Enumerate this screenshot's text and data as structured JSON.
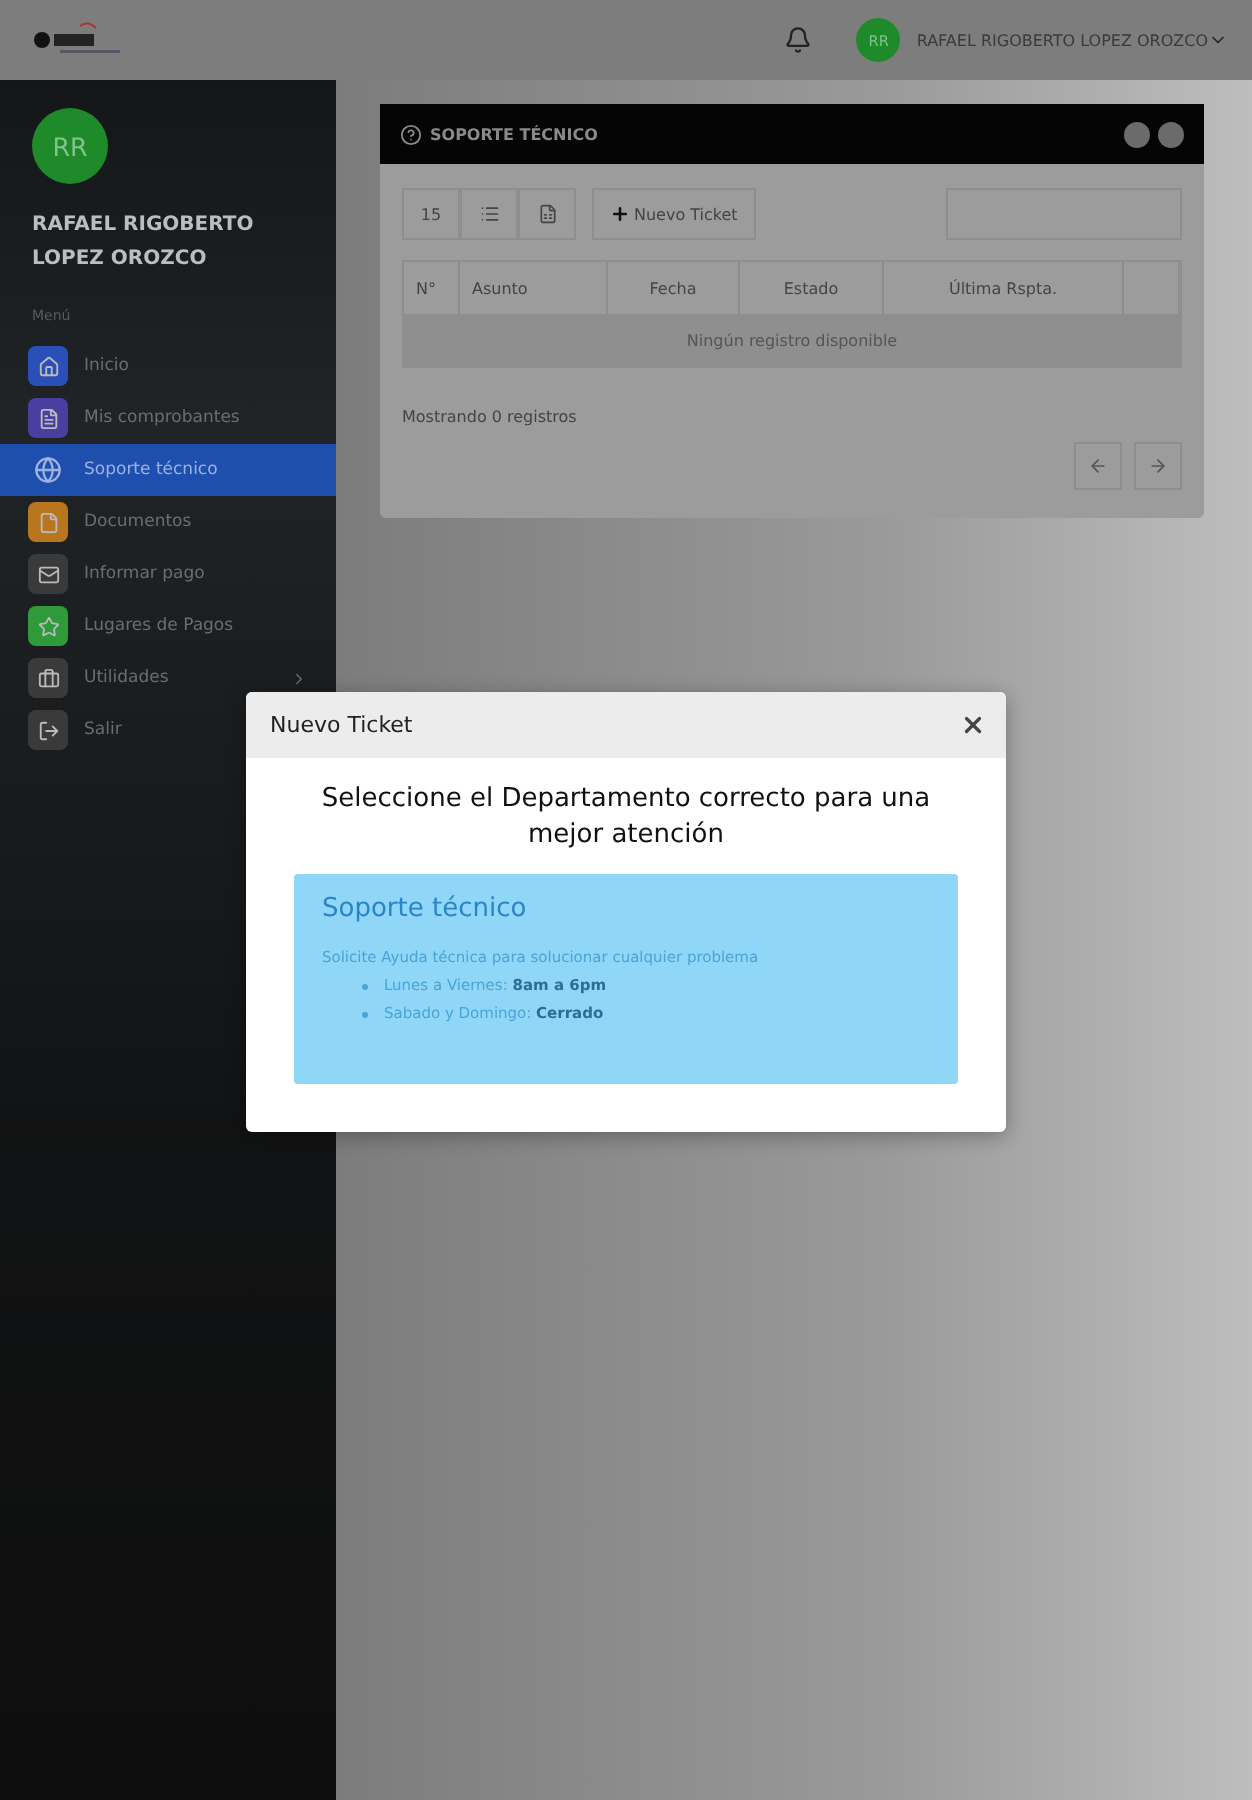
{
  "header": {
    "user_initials": "RR",
    "user_name": "RAFAEL RIGOBERTO LOPEZ OROZCO"
  },
  "sidebar": {
    "initials": "RR",
    "name": "RAFAEL RIGOBERTO LOPEZ OROZCO",
    "section": "Menú",
    "items": [
      {
        "label": "Inicio",
        "kind": "home",
        "color": "#2b4fb8",
        "selected": false
      },
      {
        "label": "Mis comprobantes",
        "kind": "receipt",
        "color": "#4a3fa0",
        "selected": false
      },
      {
        "label": "Soporte técnico",
        "kind": "globe",
        "selected": true
      },
      {
        "label": "Documentos",
        "kind": "document",
        "color": "#b8761e",
        "selected": false
      },
      {
        "label": "Informar pago",
        "kind": "mail",
        "color": "#3a3a3a",
        "selected": false
      },
      {
        "label": "Lugares de Pagos",
        "kind": "star",
        "color": "#2e9a3a",
        "selected": false
      },
      {
        "label": "Utilidades",
        "kind": "briefcase",
        "color": "#3a3a3a",
        "selected": false,
        "submenu": true
      },
      {
        "label": "Salir",
        "kind": "exit",
        "color": "#3a3a3a",
        "selected": false
      }
    ]
  },
  "card": {
    "title": "SOPORTE TÉCNICO",
    "page_size": "15",
    "new_button": "Nuevo Ticket",
    "columns": [
      "N°",
      "Asunto",
      "Fecha",
      "Estado",
      "Última Rspta."
    ],
    "empty": "Ningún registro disponible",
    "footer": "Mostrando 0 registros"
  },
  "modal": {
    "title": "Nuevo Ticket",
    "heading": "Seleccione el Departamento correcto para una mejor atención",
    "department": {
      "title": "Soporte técnico",
      "description": "Solicite Ayuda técnica para solucionar cualquier problema",
      "hours": [
        "Lunes a Viernes: **8am a 6pm**",
        "Sabado y Domingo: **Cerrado**"
      ]
    }
  }
}
